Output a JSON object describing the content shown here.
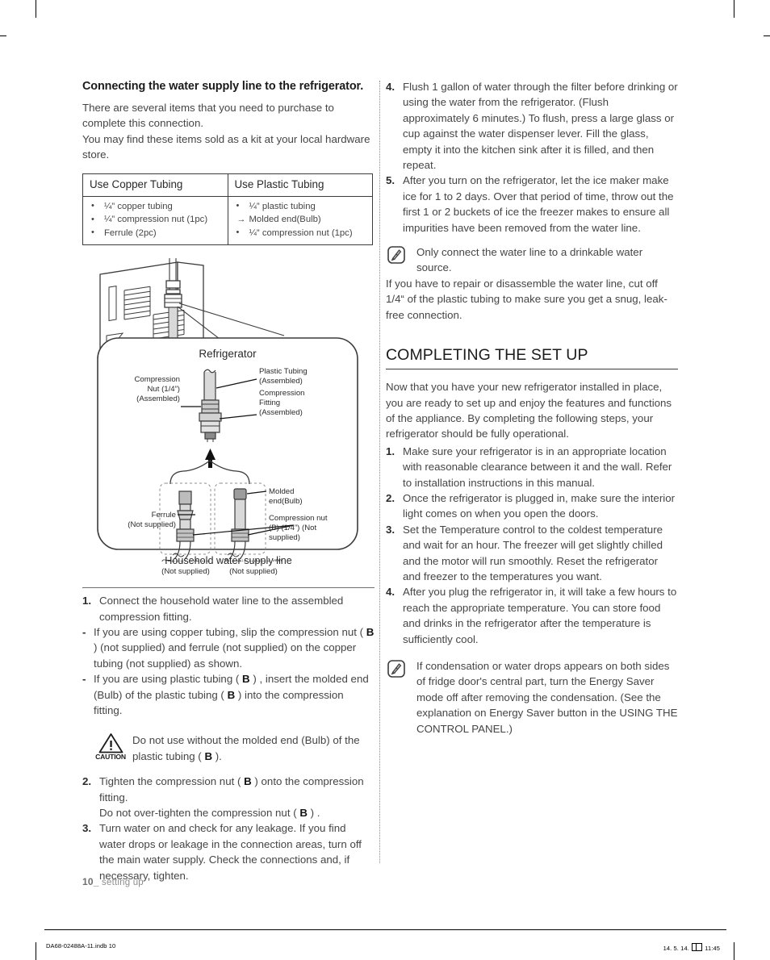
{
  "page": {
    "number_label": "10_",
    "footer_section": " setting up",
    "slug_left": "DA68-02488A-11.indb   10",
    "slug_date": "14. 5. 14.",
    "slug_time": "11:45"
  },
  "left_column": {
    "heading": "Connecting the water supply line to the refrigerator.",
    "intro": [
      "There are several items that you need to purchase to complete this connection.",
      "You may find these items sold as a kit at your local hardware store."
    ],
    "table": {
      "headers": [
        "Use Copper Tubing",
        "Use Plastic Tubing"
      ],
      "copper_items": [
        {
          "marker": "bullet",
          "text": "¼” copper tubing"
        },
        {
          "marker": "bullet",
          "text": "¼” compression nut (1pc)"
        },
        {
          "marker": "bullet",
          "text": "Ferrule (2pc)"
        }
      ],
      "plastic_items": [
        {
          "marker": "bullet",
          "text": "¼” plastic tubing"
        },
        {
          "marker": "arrow",
          "text": "Molded end(Bulb)"
        },
        {
          "marker": "bullet",
          "text": "¼” compression nut (1pc)"
        }
      ]
    },
    "figure": {
      "title": "Refrigerator",
      "caption": "Household water supply line",
      "labels": {
        "compression_nut_assembled": "Compression\nNut (1/4”)\n(Assembled)",
        "plastic_tubing_assembled": "Plastic Tubing\n(Assembled)",
        "compression_fitting_assembled": "Compression\nFitting\n(Assembled)",
        "ferrule": "Ferrule\n(Not supplied)",
        "molded_end": "Molded\nend(Bulb)",
        "compression_nut_b": "Compression nut\n(B) (1/4”) (Not\nsupplied)",
        "copper_tubing": "Copper tubing\n(Not supplied)",
        "plastic_tubing_b": "Plastic tubing (B)\n(Not supplied)",
        "or": "or"
      },
      "label_lines": {
        "compression_nut_assembled": [
          "Compression",
          "Nut (1/4”)",
          "(Assembled)"
        ],
        "plastic_tubing_assembled": [
          "Plastic Tubing",
          "(Assembled)"
        ],
        "compression_fitting_assembled": [
          "Compression",
          "Fitting",
          "(Assembled)"
        ],
        "ferrule": [
          "Ferrule",
          "(Not supplied)"
        ],
        "molded_end": [
          "Molded",
          "end(Bulb)"
        ],
        "compression_nut_b": [
          "Compression nut",
          "(B) (1/4”) (Not",
          "supplied)"
        ],
        "copper_tubing": [
          "Copper tubing",
          "(Not supplied)"
        ],
        "plastic_tubing_b": [
          "Plastic tubing (B)",
          "(Not supplied)"
        ]
      }
    },
    "steps": [
      {
        "marker": "1.",
        "type": "number",
        "text": "Connect the household water line to the assembled compression fitting."
      },
      {
        "marker": "-",
        "type": "dash",
        "html": "If you are using copper tubing, slip the compression nut ( <b class=\"bmark\">B</b> ) (not supplied) and ferrule (not supplied) on the copper tubing (not supplied) as shown."
      },
      {
        "marker": "-",
        "type": "dash",
        "html": "If you are using plastic tubing ( <b class=\"bmark\">B</b> ) , insert the molded end (Bulb) of the plastic tubing ( <b class=\"bmark\">B</b> ) into the compression fitting."
      }
    ],
    "caution": {
      "label": "CAUTION",
      "html": "Do not use without the molded end (Bulb) of the plastic tubing ( <b class=\"bmark\">B</b> )."
    },
    "steps2": [
      {
        "marker": "2.",
        "type": "number",
        "html": "Tighten the compression nut ( <b class=\"bmark\">B</b> ) onto the compression fitting.<br>Do not over-tighten the compression nut ( <b class=\"bmark\">B</b> ) ."
      },
      {
        "marker": "3.",
        "type": "number",
        "html": "Turn water on and check for any leakage. If you find water drops or leakage in the connection areas, turn off the main water supply. Check the connections and, if necessary, tighten."
      }
    ]
  },
  "right_column": {
    "steps": [
      {
        "marker": "4.",
        "text": "Flush 1 gallon of water through the filter before drinking or using the water from the refrigerator. (Flush approximately 6 minutes.) To flush, press a large glass or cup against the water dispenser lever. Fill the glass, empty it into the kitchen sink after it is filled, and then repeat."
      },
      {
        "marker": "5.",
        "text": "After you turn on the refrigerator, let the ice maker make ice for 1 to 2 days. Over that period of time, throw out the first 1 or 2 buckets of ice the freezer makes to ensure all impurities have been removed from the water line."
      }
    ],
    "note1": {
      "icon": "note-pen-icon",
      "text": "Only connect the water line to a drinkable water source.",
      "continuation": "If you have to repair or disassemble the water line, cut off 1/4“ of the plastic tubing to make sure you get a snug, leak-free connection."
    },
    "section_title": "COMPLETING THE SET UP",
    "section_intro": "Now that you have your new refrigerator installed in place, you are ready to set up and enjoy the features and functions of the appliance. By completing the following steps, your refrigerator should be fully operational.",
    "setup_steps": [
      {
        "marker": "1.",
        "text": "Make sure your refrigerator is in an appropriate location with reasonable clearance between it and the wall. Refer to installation instructions in this manual."
      },
      {
        "marker": "2.",
        "text": "Once the refrigerator is plugged in, make sure the interior light comes on when you open the doors."
      },
      {
        "marker": "3.",
        "text": "Set the Temperature control to the coldest temperature and wait for an hour. The freezer will get slightly chilled and the motor will run smoothly. Reset the refrigerator and freezer to the temperatures you want."
      },
      {
        "marker": "4.",
        "text": "After you plug the refrigerator in, it will take a few hours to reach the appropriate temperature. You can store food and drinks in the refrigerator after the temperature is sufficiently cool."
      }
    ],
    "note2": {
      "icon": "note-pen-icon",
      "text": "If condensation or water drops appears on both sides of fridge door's central part, turn the Energy Saver mode off after removing the condensation. (See the explanation on Energy Saver button in the USING THE CONTROL PANEL.)"
    }
  },
  "colors": {
    "text": "#454545",
    "heading": "#1b1b1b",
    "rule": "#3b3b3b",
    "muted": "#8c8c8c",
    "tube_fill": "#d9d9d9",
    "nut_fill": "#c4c4c4"
  }
}
